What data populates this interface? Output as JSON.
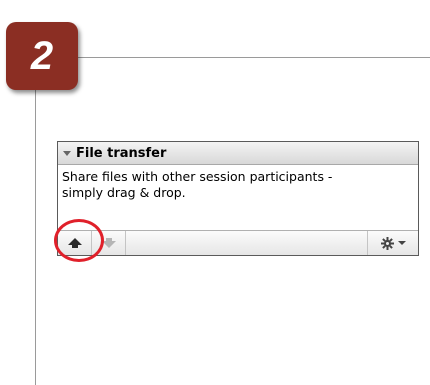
{
  "step": {
    "number": "2",
    "badge_color": "#8b2e23"
  },
  "panel": {
    "title": "File transfer",
    "collapse_icon": "collapse-triangle-icon",
    "description_line1": "Share files with other session participants -",
    "description_line2": "simply drag & drop."
  },
  "toolbar": {
    "buttons": [
      {
        "name": "upload",
        "icon": "upload-arrow-icon",
        "enabled": true
      },
      {
        "name": "download",
        "icon": "download-arrow-icon",
        "enabled": false
      },
      {
        "name": "settings",
        "icon": "gear-icon",
        "has_dropdown": true
      }
    ]
  },
  "highlight": {
    "target": "upload",
    "color": "#e0202a"
  }
}
